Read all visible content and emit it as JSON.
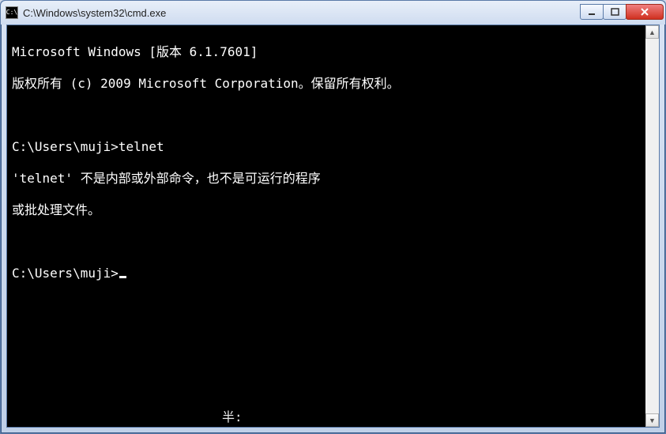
{
  "window": {
    "title": "C:\\Windows\\system32\\cmd.exe",
    "app_icon_label": "cmd"
  },
  "controls": {
    "minimize": "minimize",
    "maximize": "maximize",
    "close": "close"
  },
  "terminal": {
    "lines": [
      "Microsoft Windows [版本 6.1.7601]",
      "版权所有 (c) 2009 Microsoft Corporation。保留所有权利。",
      "",
      "C:\\Users\\muji>telnet",
      "'telnet' 不是内部或外部命令，也不是可运行的程序",
      "或批处理文件。",
      "",
      "C:\\Users\\muji>"
    ],
    "prompt_current": "C:\\Users\\muji>",
    "has_cursor": true
  },
  "ime": {
    "status": "半:"
  },
  "scrollbar": {
    "up": "▲",
    "down": "▼"
  }
}
